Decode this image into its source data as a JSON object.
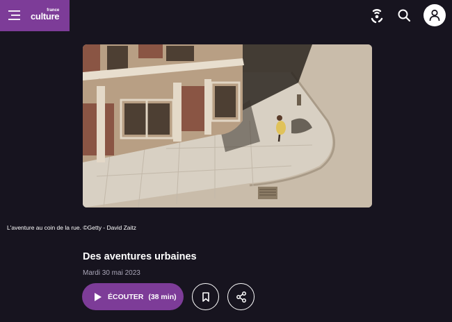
{
  "header": {
    "logo_small": "france",
    "logo_big": "culture"
  },
  "article": {
    "caption": "L'aventure au coin de la rue. ©Getty - David Zaitz",
    "title": "Des aventures urbaines",
    "date": "Mardi 30 mai 2023"
  },
  "player": {
    "play_label": "ÉCOUTER",
    "duration": "(38 min)"
  },
  "colors": {
    "background": "#17141f",
    "brand_purple": "#7d3c98",
    "date_gray": "#aaa6b8"
  },
  "icons": [
    "menu-icon",
    "radio-wave-icon",
    "search-icon",
    "user-icon",
    "play-icon",
    "bookmark-icon",
    "share-icon"
  ]
}
